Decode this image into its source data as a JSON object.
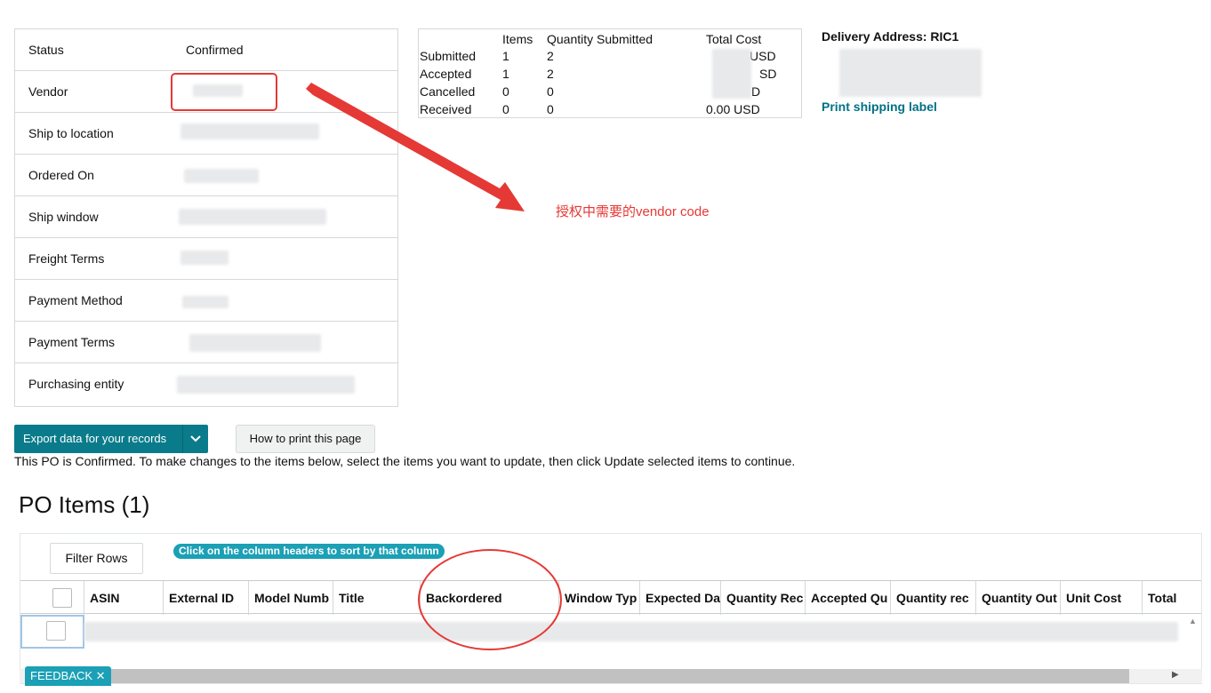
{
  "details": {
    "rows": [
      {
        "label": "Status",
        "value": "Confirmed"
      },
      {
        "label": "Vendor",
        "value": ""
      },
      {
        "label": "Ship to location",
        "value": ""
      },
      {
        "label": "Ordered On",
        "value": ""
      },
      {
        "label": "Ship window",
        "value": ""
      },
      {
        "label": "Freight Terms",
        "value": ""
      },
      {
        "label": "Payment Method",
        "value": ""
      },
      {
        "label": "Payment Terms",
        "value": ""
      },
      {
        "label": "Purchasing entity",
        "value": ""
      }
    ]
  },
  "summary": {
    "headers": {
      "items": "Items",
      "quantity": "Quantity Submitted",
      "cost": "Total Cost"
    },
    "rows": [
      {
        "label": "Submitted",
        "items": "1",
        "quantity": "2",
        "cost": "USD"
      },
      {
        "label": "Accepted",
        "items": "1",
        "quantity": "2",
        "cost": "SD"
      },
      {
        "label": "Cancelled",
        "items": "0",
        "quantity": "0",
        "cost": "D"
      },
      {
        "label": "Received",
        "items": "0",
        "quantity": "0",
        "cost": "0.00 USD"
      }
    ]
  },
  "delivery": {
    "title": "Delivery Address: RIC1",
    "print_label": "Print shipping label"
  },
  "annotation": {
    "text": "授权中需要的vendor code"
  },
  "actions": {
    "export_label": "Export data for your records",
    "howto_label": "How to print this page",
    "info_text": "This PO is Confirmed. To make changes to the items below, select the items you want to update, then click Update selected items to continue."
  },
  "po_items": {
    "title": "PO Items (1)",
    "filter_label": "Filter Rows",
    "sort_hint": "Click on the column headers to sort by that column",
    "columns": [
      "ASIN",
      "External ID",
      "Model Numb",
      "Title",
      "Backordered",
      "Window Typ",
      "Expected Da",
      "Quantity Rec",
      "Accepted Qu",
      "Quantity rec",
      "Quantity Out",
      "Unit Cost",
      "Total"
    ]
  },
  "feedback": {
    "label": "FEEDBACK ✕"
  },
  "colors": {
    "accent": "#0a7b8a",
    "link": "#007185",
    "annotation": "#e53935",
    "pill": "#1ba0b6"
  }
}
